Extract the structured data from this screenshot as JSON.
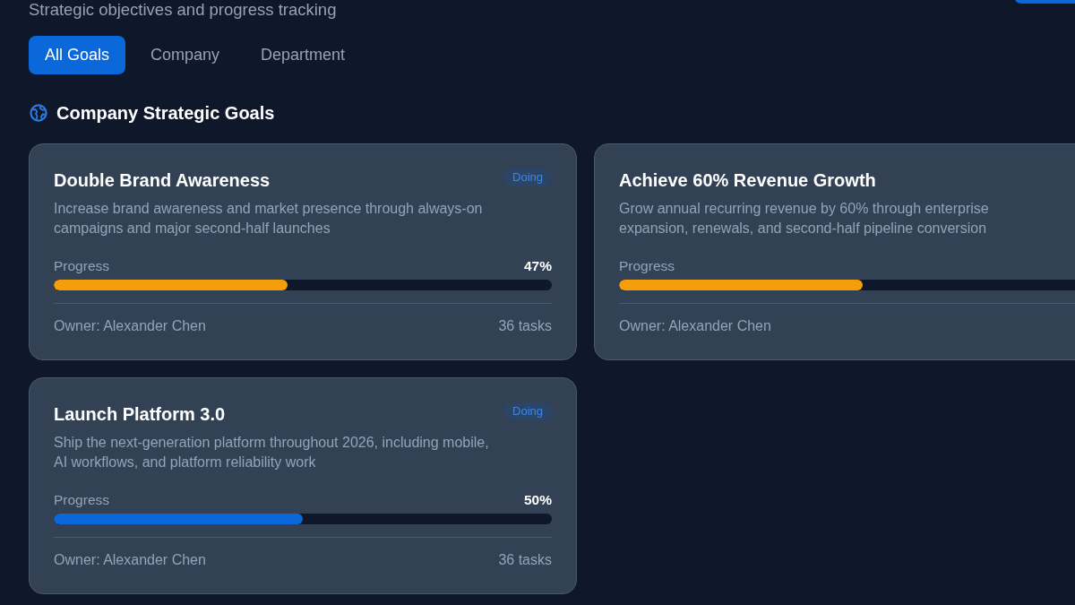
{
  "header": {
    "subtitle": "Strategic objectives and progress tracking"
  },
  "tabs": [
    {
      "label": "All Goals",
      "selected": true
    },
    {
      "label": "Company",
      "selected": false
    },
    {
      "label": "Department",
      "selected": false
    }
  ],
  "section": {
    "title": "Company Strategic Goals"
  },
  "goals": [
    {
      "title": "Double Brand Awareness",
      "status": "Doing",
      "description": "Increase brand awareness and market presence through always-on campaigns and major second-half launches",
      "progress_label": "Progress",
      "percent": "47%",
      "level": 0.47,
      "color": "#f59e0b",
      "owner": "Owner: Alexander Chen",
      "tasks": "36 tasks"
    },
    {
      "title": "Achieve 60% Revenue Growth",
      "description": "Grow annual recurring revenue by 60% through enterprise expansion, renewals, and second-half pipeline conversion",
      "progress_label": "Progress",
      "level": 0.49,
      "color": "#f59e0b",
      "owner": "Owner: Alexander Chen"
    },
    {
      "title": "Launch Platform 3.0",
      "status": "Doing",
      "description": "Ship the next-generation platform throughout 2026, including mobile, AI workflows, and platform reliability work",
      "progress_label": "Progress",
      "percent": "50%",
      "level": 0.5,
      "color": "#0b68da",
      "owner": "Owner: Alexander Chen",
      "tasks": "36 tasks"
    }
  ]
}
